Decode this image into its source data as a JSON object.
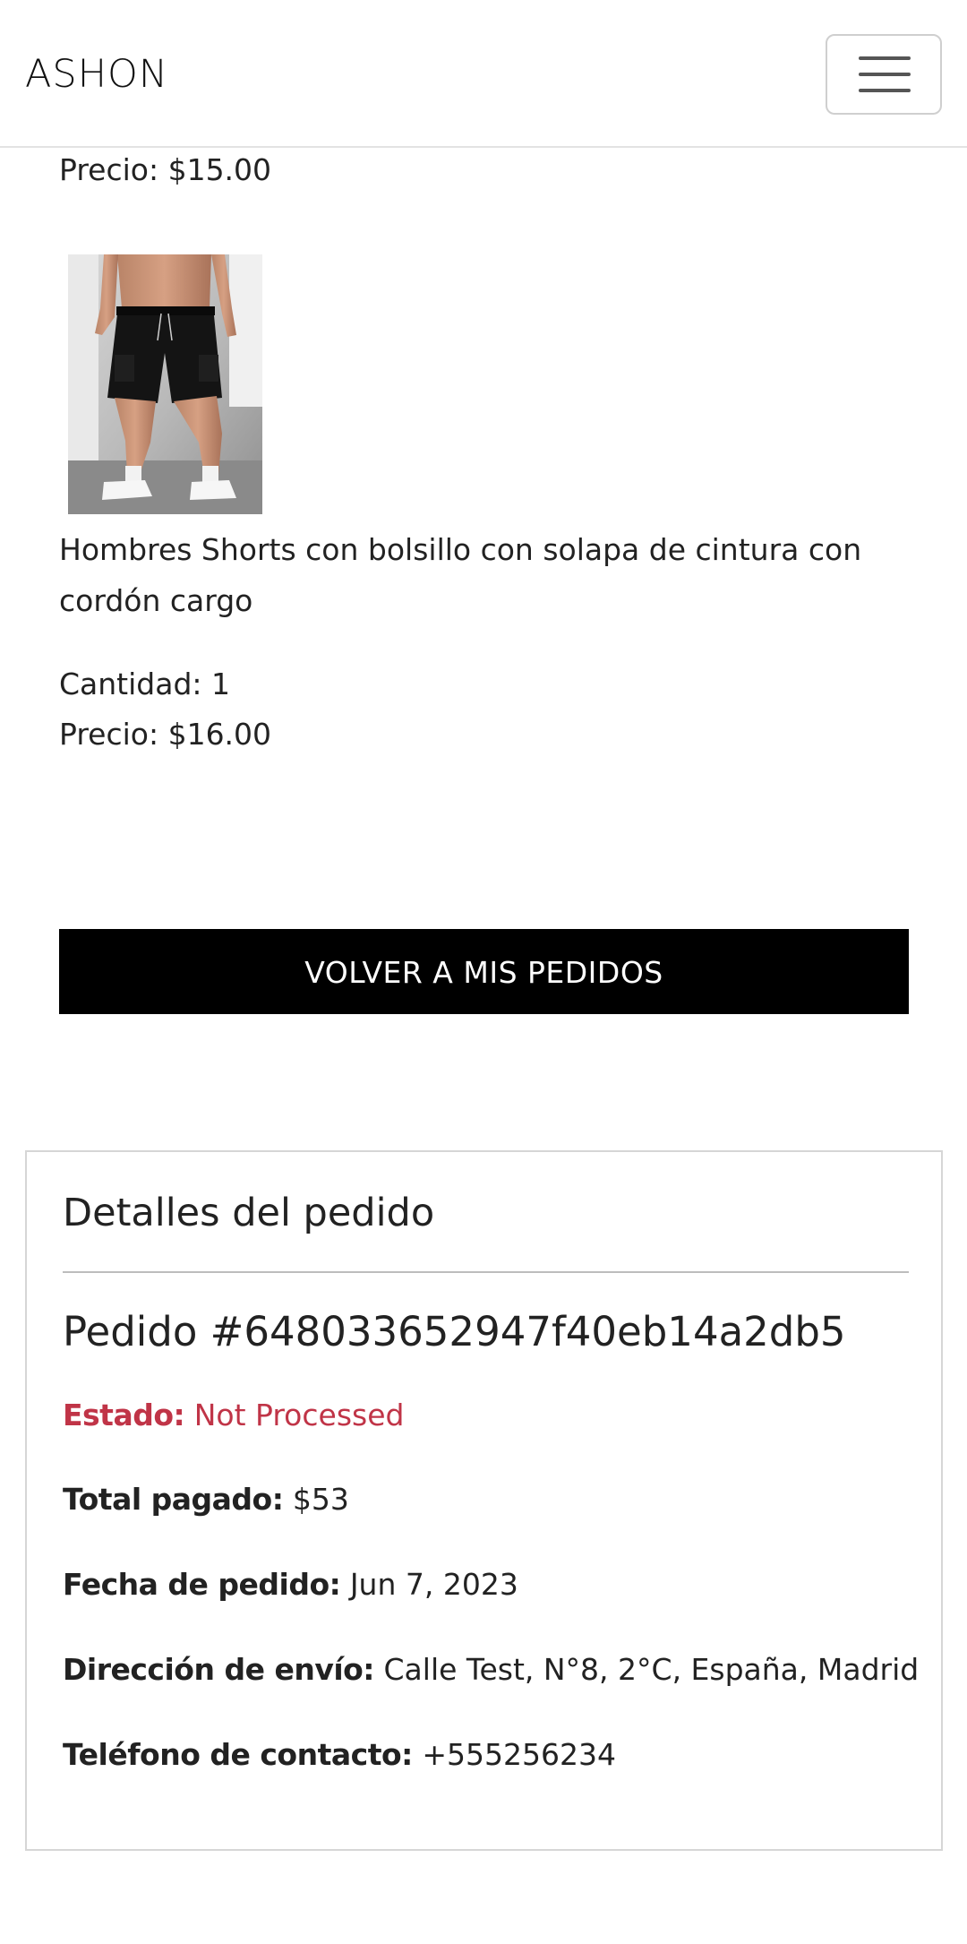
{
  "navbar": {
    "brand": "ASHON",
    "menu_icon": "hamburger-menu-icon"
  },
  "previous_item": {
    "price": "Precio: $15.00"
  },
  "item": {
    "image_icon": "product-photo-black-cargo-shorts",
    "name": "Hombres Shorts con bolsillo con solapa de cintura con cordón cargo",
    "quantity": "Cantidad: 1",
    "price": "Precio: $16.00"
  },
  "back_button": {
    "label": "VOLVER A MIS PEDIDOS"
  },
  "order_details": {
    "title": "Detalles del pedido",
    "order_id": "Pedido #648033652947f40eb14a2db5",
    "status_label": "Estado:",
    "status_value": "Not Processed",
    "total_label": "Total pagado:",
    "total_value": "$53",
    "date_label": "Fecha de pedido:",
    "date_value": "Jun 7, 2023",
    "address_label": "Dirección de envío:",
    "address_value": "Calle Test, N°8, 2°C, España, Madrid",
    "phone_label": "Teléfono de contacto:",
    "phone_value": "+555256234"
  },
  "colors": {
    "status": "#c03447",
    "button_bg": "#000000",
    "button_text": "#ffffff"
  }
}
